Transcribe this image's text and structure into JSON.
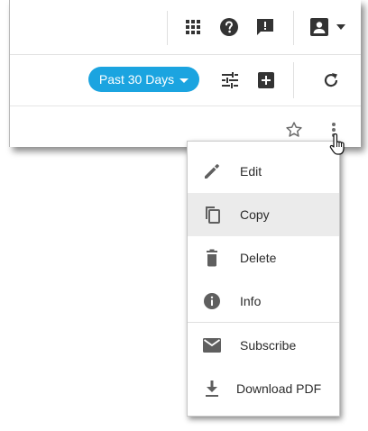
{
  "toolbar": {
    "date_filter": {
      "label": "Past 30 Days"
    }
  },
  "menu": {
    "items": [
      {
        "label": "Edit",
        "icon": "pencil-icon"
      },
      {
        "label": "Copy",
        "icon": "copy-icon"
      },
      {
        "label": "Delete",
        "icon": "trash-icon"
      },
      {
        "label": "Info",
        "icon": "info-icon"
      },
      {
        "label": "Subscribe",
        "icon": "mail-icon"
      },
      {
        "label": "Download PDF",
        "icon": "download-icon"
      }
    ],
    "highlighted_item": "Copy"
  },
  "colors": {
    "accent": "#1ba4e0",
    "icon": "#333333",
    "menu_icon": "#5f5f5f",
    "highlight": "#ebebeb"
  }
}
